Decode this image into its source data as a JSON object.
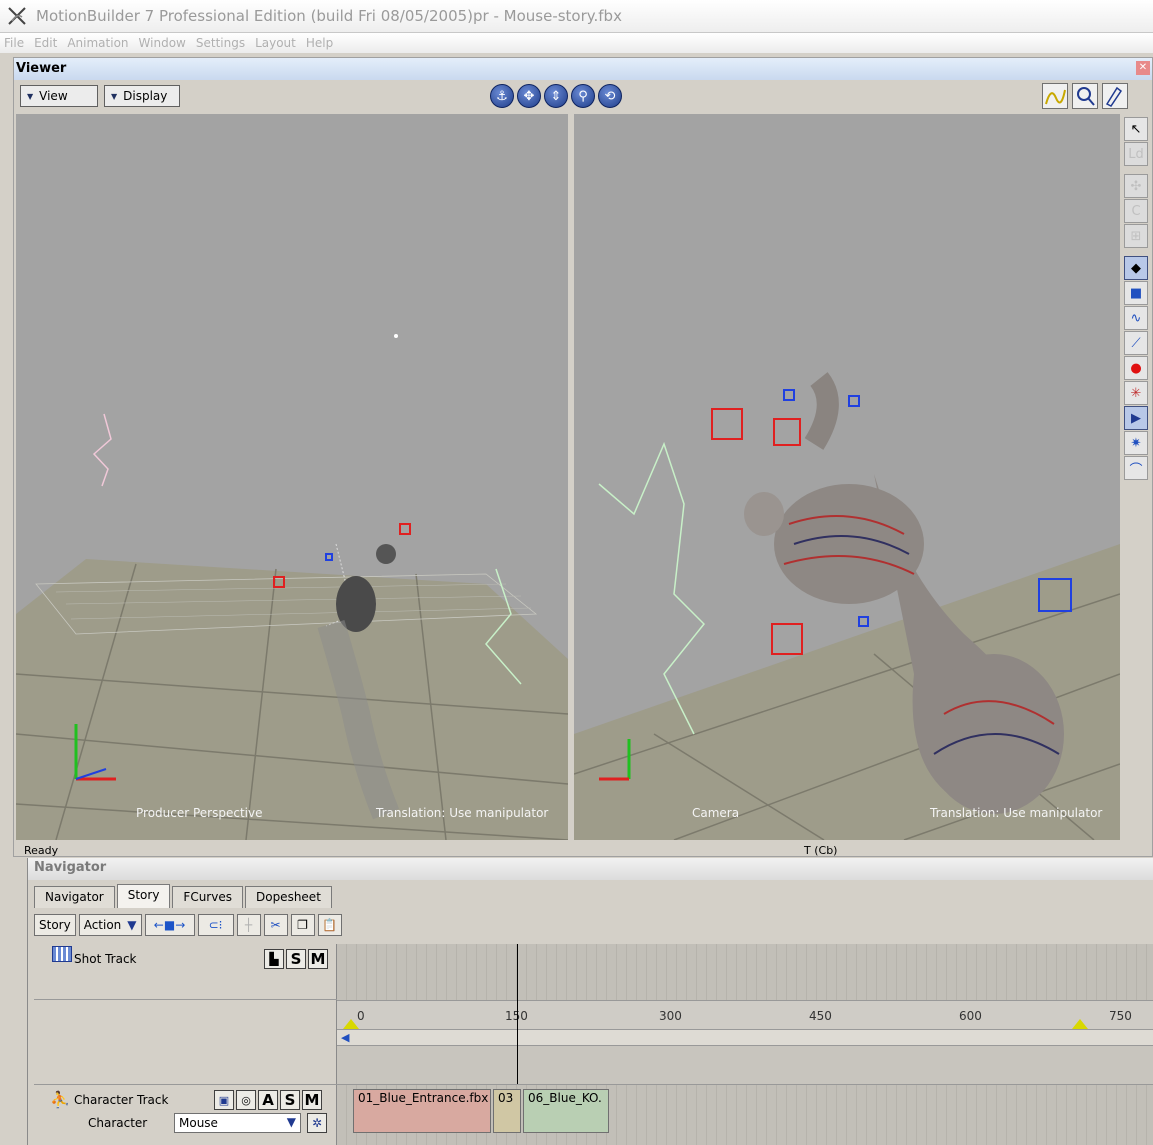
{
  "window": {
    "title": "MotionBuilder 7 Professional Edition (build Fri 08/05/2005)pr - Mouse-story.fbx"
  },
  "menu": [
    "File",
    "Edit",
    "Animation",
    "Window",
    "Settings",
    "Layout",
    "Help"
  ],
  "viewer": {
    "title": "Viewer",
    "view_label": "View",
    "display_label": "Display",
    "nav_icons": [
      "anchor-icon",
      "move-icon",
      "dolly-icon",
      "zoom-icon",
      "orbit-icon"
    ],
    "left_pane": {
      "label": "Producer Perspective",
      "translation": "Translation: Use manipulator"
    },
    "right_pane": {
      "label": "Camera",
      "translation": "Translation: Use manipulator"
    },
    "status": "Ready",
    "tc_label": "T (Cb)"
  },
  "navigator": {
    "title": "Navigator",
    "tabs": [
      "Navigator",
      "Story",
      "FCurves",
      "Dopesheet"
    ],
    "active_tab": "Story",
    "toolbar": {
      "story_label": "Story",
      "action_label": "Action"
    },
    "shot_track": {
      "label": "Shot Track",
      "s": "S",
      "m": "M"
    },
    "character_track": {
      "label": "Character Track",
      "a": "A",
      "s": "S",
      "m": "M",
      "character_label": "Character",
      "character_value": "Mouse"
    },
    "ruler": [
      "0",
      "150",
      "300",
      "450",
      "600",
      "750"
    ],
    "clips": [
      "01_Blue_Entrance.fbx",
      "03",
      "06_Blue_KO."
    ]
  },
  "colors": {
    "viewport_bg": "#a3a3a3",
    "clip_red": "#d8a9a0",
    "clip_green": "#b9cfb3"
  }
}
